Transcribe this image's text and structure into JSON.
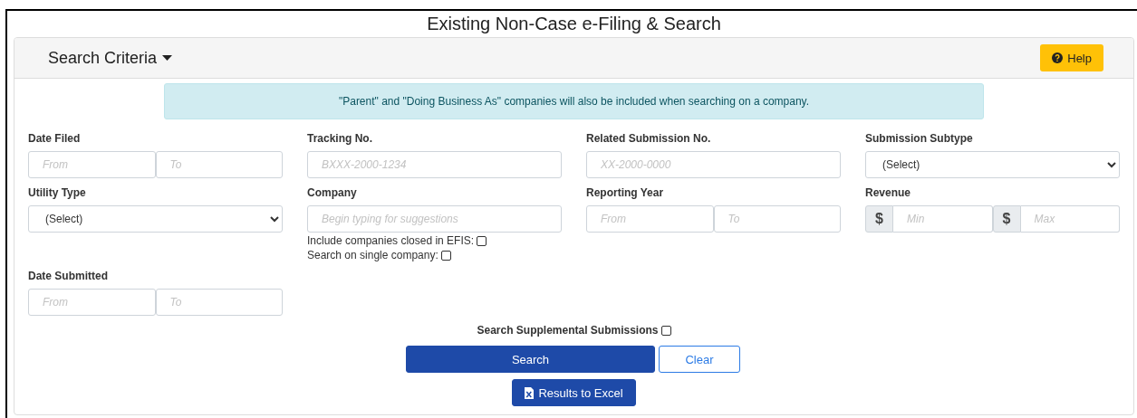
{
  "page_title": "Existing Non-Case e-Filing & Search",
  "panel": {
    "title": "Search Criteria",
    "help_button": "Help"
  },
  "notice": "\"Parent\" and \"Doing Business As\" companies will also be included when searching on a company.",
  "fields": [
    {
      "label": "Date Filed",
      "kind": "range",
      "from_placeholder": "From",
      "to_placeholder": "To"
    },
    {
      "label": "Tracking No.",
      "kind": "text",
      "placeholder": "BXXX-2000-1234"
    },
    {
      "label": "Related Submission No.",
      "kind": "text",
      "placeholder": "XX-2000-0000"
    },
    {
      "label": "Submission Subtype",
      "kind": "select",
      "value": "(Select)"
    },
    {
      "label": "Utility Type",
      "kind": "select",
      "value": "(Select)"
    },
    {
      "label": "Company",
      "kind": "text",
      "placeholder": "Begin typing for suggestions",
      "options": [
        {
          "label": "Include companies closed in EFIS:",
          "checked": false
        },
        {
          "label": "Search on single company:",
          "checked": false
        }
      ]
    },
    {
      "label": "Reporting Year",
      "kind": "range",
      "from_placeholder": "From",
      "to_placeholder": "To"
    },
    {
      "label": "Revenue",
      "kind": "money",
      "prefix": "$",
      "min_placeholder": "Min",
      "max_prefix": "$",
      "max_placeholder": "Max"
    },
    {
      "label": "Date Submitted",
      "kind": "range",
      "from_placeholder": "From",
      "to_placeholder": "To"
    }
  ],
  "supplemental": {
    "label": "Search Supplemental Submissions",
    "checked": false
  },
  "buttons": [
    {
      "label": "Search",
      "kind": "primary"
    },
    {
      "label": "Clear",
      "kind": "outline"
    }
  ],
  "excel_button": "Results to Excel"
}
